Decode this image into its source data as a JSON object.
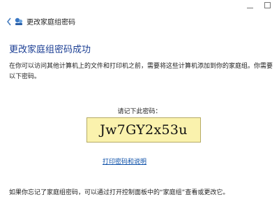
{
  "window": {
    "title": "更改家庭组密码"
  },
  "main": {
    "heading": "更改家庭组密码成功",
    "description": "在你可以访问其他计算机上的文件和打印机之前，需要将这些计算机添加到你的家庭组。你需要以下密码。",
    "password_label": "请记下此密码：",
    "password": "Jw7GY2x53u",
    "print_link": "打印密码和说明",
    "footer": "如果你忘记了家庭组密码，可以通过打开控制面板中的“家庭组”查看或更改它。"
  },
  "icons": {
    "back": "back-arrow-icon",
    "homegroup": "homegroup-icon"
  },
  "colors": {
    "heading": "#1c3f94",
    "link": "#0b4fa8",
    "password_box": "#faf2ad"
  }
}
